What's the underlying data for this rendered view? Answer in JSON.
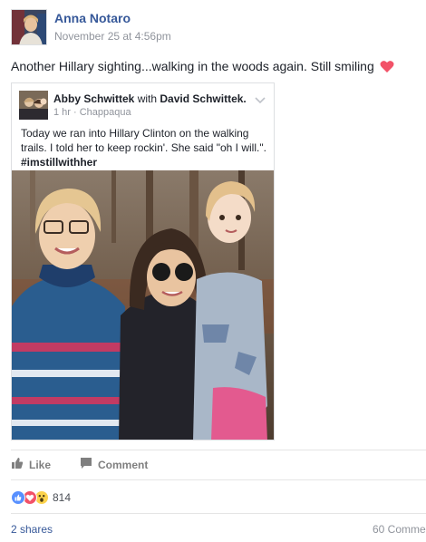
{
  "post": {
    "author": "Anna Notaro",
    "timestamp": "November 25 at 4:56pm",
    "text": "Another Hillary sighting...walking in the woods again. Still smiling",
    "heart_color": "#f25268"
  },
  "shared_post": {
    "author": "Abby Schwittek",
    "with_word": "with",
    "tagged": "David Schwittek.",
    "meta": "1 hr · Chappaqua",
    "text": "Today we  ran into Hillary Clinton on the walking trails.  I told her to keep rockin'.  She said \"oh I will.\".",
    "hashtag": "#imstillwithher"
  },
  "actions": {
    "like_label": "Like",
    "comment_label": "Comment"
  },
  "reactions": {
    "icons": [
      "like-icon",
      "love-icon",
      "wow-icon"
    ],
    "count": "814"
  },
  "footer": {
    "shares": "2 shares",
    "comments": "60 Comme"
  },
  "colors": {
    "link_blue": "#365899",
    "like_blue": "#5890ff",
    "love_red": "#f25268",
    "wow_yellow": "#fcd34d"
  }
}
